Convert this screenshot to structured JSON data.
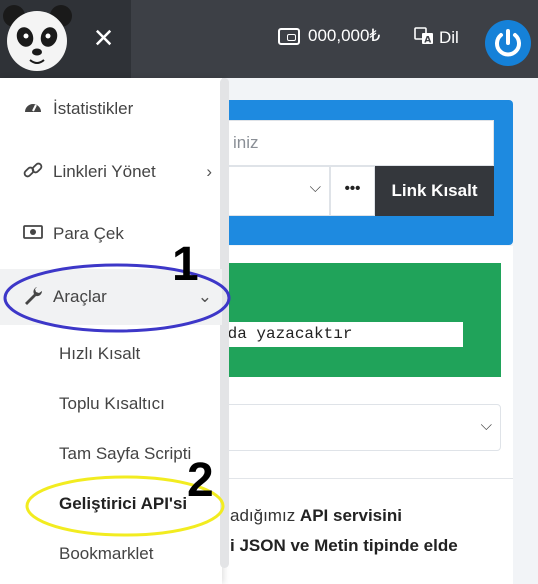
{
  "topbar": {
    "menu_icon": "close-icon",
    "wallet_icon": "wallet-icon",
    "balance": "000,000₺",
    "lang_icon": "translate-icon",
    "lang_label": "Dil",
    "power_icon": "power-icon",
    "logo": "panda-logo"
  },
  "main": {
    "url_placeholder": "iniz",
    "shorten_label": "Link Kısalt",
    "more_label": "•••",
    "code_text": "rda yazacaktır",
    "paragraph1_pre": "adığımız ",
    "paragraph1_bold": "API servisini",
    "paragraph2": "i JSON ve Metin tipinde elde"
  },
  "sidebar": {
    "items": [
      {
        "label": "İstatistikler",
        "icon": "dashboard-icon"
      },
      {
        "label": "Linkleri Yönet",
        "icon": "link-icon",
        "arrow": "›"
      },
      {
        "label": "Para Çek",
        "icon": "money-icon"
      },
      {
        "label": "Araçlar",
        "icon": "wrench-icon",
        "arrow": "⌄"
      }
    ],
    "subitems": [
      {
        "label": "Hızlı Kısalt"
      },
      {
        "label": "Toplu Kısaltıcı"
      },
      {
        "label": "Tam Sayfa Scripti"
      },
      {
        "label": "Geliştirici API'si"
      },
      {
        "label": "Bookmarklet"
      }
    ]
  },
  "annotations": {
    "marker1": "1",
    "marker2": "2",
    "ellipse1_color": "#3d37c8",
    "ellipse2_color": "#f2ec20"
  },
  "colors": {
    "topbar": "#3d4046",
    "accent_blue": "#1e8ae0",
    "green": "#20a35a",
    "dark_button": "#34373c"
  }
}
